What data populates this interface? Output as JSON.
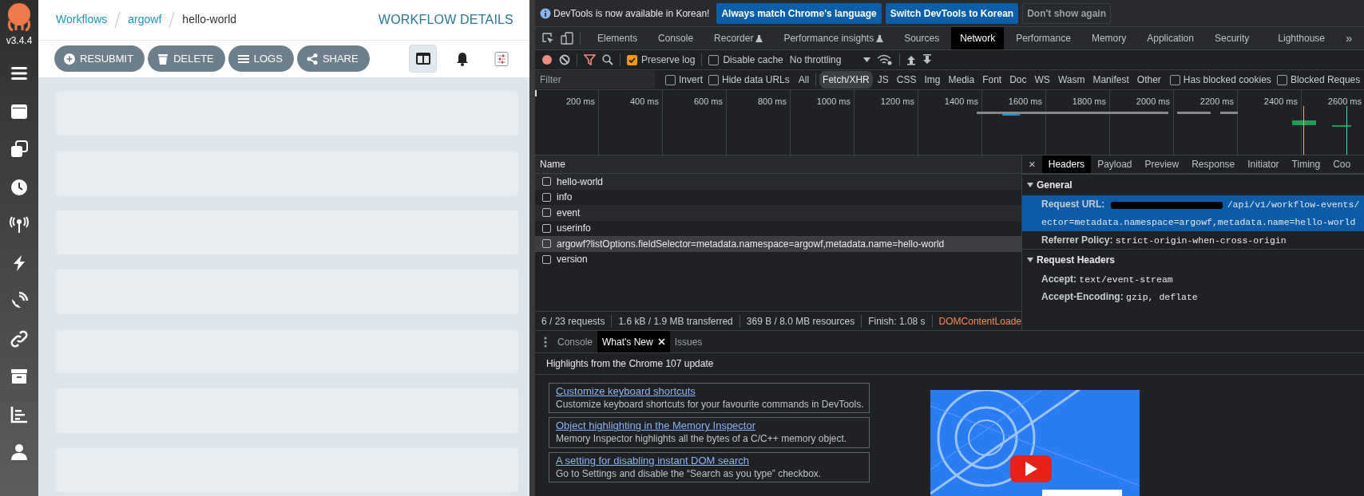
{
  "app": {
    "version": "v3.4.4",
    "breadcrumbs": [
      {
        "label": "Workflows",
        "link": true
      },
      {
        "label": "argowf",
        "link": true
      },
      {
        "label": "hello-world",
        "link": false
      }
    ],
    "page_title": "WORKFLOW DETAILS",
    "actions": [
      {
        "kind": "resubmit",
        "label": "RESUBMIT"
      },
      {
        "kind": "delete",
        "label": "DELETE"
      },
      {
        "kind": "logs",
        "label": "LOGS"
      },
      {
        "kind": "share",
        "label": "SHARE"
      }
    ],
    "view_buttons": [
      {
        "kind": "split",
        "selected": true
      },
      {
        "kind": "bell",
        "selected": false
      },
      {
        "kind": "settings",
        "selected": false
      }
    ]
  },
  "devtools": {
    "infobar": {
      "message": "DevTools is now available in Korean!",
      "buttons": [
        {
          "label": "Always match Chrome's language",
          "primary": true
        },
        {
          "label": "Switch DevTools to Korean",
          "primary": true
        },
        {
          "label": "Don't show again",
          "primary": false
        }
      ]
    },
    "tabs": [
      {
        "label": "Elements",
        "selected": false,
        "experimental": false
      },
      {
        "label": "Console",
        "selected": false,
        "experimental": false
      },
      {
        "label": "Recorder",
        "selected": false,
        "experimental": true
      },
      {
        "label": "Performance insights",
        "selected": false,
        "experimental": true
      },
      {
        "label": "Sources",
        "selected": false,
        "experimental": false
      },
      {
        "label": "Network",
        "selected": true,
        "experimental": false
      },
      {
        "label": "Performance",
        "selected": false,
        "experimental": false
      },
      {
        "label": "Memory",
        "selected": false,
        "experimental": false
      },
      {
        "label": "Application",
        "selected": false,
        "experimental": false
      },
      {
        "label": "Security",
        "selected": false,
        "experimental": false
      },
      {
        "label": "Lighthouse",
        "selected": false,
        "experimental": false
      }
    ],
    "more_tabs": "»",
    "toolbar": {
      "recording": true,
      "preserve_log": {
        "label": "Preserve log",
        "checked": true
      },
      "disable_cache": {
        "label": "Disable cache",
        "checked": false
      },
      "throttling": "No throttling"
    },
    "filter": {
      "placeholder": "Filter",
      "invert": {
        "label": "Invert",
        "checked": false
      },
      "hide_data_urls": {
        "label": "Hide data URLs",
        "checked": false
      },
      "types": [
        {
          "label": "All",
          "selected": false
        },
        {
          "label": "Fetch/XHR",
          "selected": true
        },
        {
          "label": "JS",
          "selected": false
        },
        {
          "label": "CSS",
          "selected": false
        },
        {
          "label": "Img",
          "selected": false
        },
        {
          "label": "Media",
          "selected": false
        },
        {
          "label": "Font",
          "selected": false
        },
        {
          "label": "Doc",
          "selected": false
        },
        {
          "label": "WS",
          "selected": false
        },
        {
          "label": "Wasm",
          "selected": false
        },
        {
          "label": "Manifest",
          "selected": false
        },
        {
          "label": "Other",
          "selected": false
        }
      ],
      "has_blocked_cookies": {
        "label": "Has blocked cookies",
        "checked": false
      },
      "blocked_requests": {
        "label": "Blocked Reques",
        "checked": false
      }
    },
    "timeline": {
      "ticks": [
        "200 ms",
        "400 ms",
        "600 ms",
        "800 ms",
        "1000 ms",
        "1200 ms",
        "1400 ms",
        "1600 ms",
        "1800 ms",
        "2000 ms",
        "2200 ms",
        "2400 ms",
        "2600 ms"
      ]
    },
    "requests": {
      "column": "Name",
      "rows": [
        {
          "name": "hello-world",
          "selected": false
        },
        {
          "name": "info",
          "selected": false
        },
        {
          "name": "event",
          "selected": false
        },
        {
          "name": "userinfo",
          "selected": false
        },
        {
          "name": "argowf?listOptions.fieldSelector=metadata.namespace=argowf,metadata.name=hello-world",
          "selected": true
        },
        {
          "name": "version",
          "selected": false
        }
      ]
    },
    "summary": [
      {
        "kind": "plain",
        "text": "6 / 23 requests"
      },
      {
        "kind": "plain",
        "text": "1.6 kB / 1.9 MB transferred"
      },
      {
        "kind": "plain",
        "text": "369 B / 8.0 MB resources"
      },
      {
        "kind": "plain",
        "text": "Finish: 1.08 s"
      },
      {
        "kind": "event",
        "text": "DOMContentLoade"
      }
    ],
    "details": {
      "close": "×",
      "tabs": [
        {
          "label": "Headers",
          "selected": true
        },
        {
          "label": "Payload",
          "selected": false
        },
        {
          "label": "Preview",
          "selected": false
        },
        {
          "label": "Response",
          "selected": false
        },
        {
          "label": "Initiator",
          "selected": false
        },
        {
          "label": "Timing",
          "selected": false
        },
        {
          "label": "Coo",
          "selected": false
        }
      ],
      "sections": [
        {
          "title": "General",
          "expanded": true,
          "rows": [
            {
              "key": "Request URL:",
              "value_lines": [
                "/api/v1/workflow-events/",
                "ector=metadata.namespace=argowf,metadata.name=hello-world"
              ],
              "selected": true,
              "redacted": true
            },
            {
              "key": "Referrer Policy:",
              "value_lines": [
                "strict-origin-when-cross-origin"
              ],
              "selected": false,
              "redacted": false
            }
          ]
        },
        {
          "title": "Request Headers",
          "expanded": true,
          "rows": [
            {
              "key": "Accept:",
              "value_lines": [
                "text/event-stream"
              ],
              "selected": false,
              "redacted": false
            },
            {
              "key": "Accept-Encoding:",
              "value_lines": [
                "gzip, deflate"
              ],
              "selected": false,
              "redacted": false
            }
          ]
        }
      ]
    },
    "drawer": {
      "tabs": [
        {
          "label": "Console",
          "selected": false,
          "closable": false
        },
        {
          "label": "What's New",
          "selected": true,
          "closable": true
        },
        {
          "label": "Issues",
          "selected": false,
          "closable": false
        }
      ],
      "heading": "Highlights from the Chrome 107 update",
      "items": [
        {
          "title": "Customize keyboard shortcuts",
          "description": "Customize keyboard shortcuts for your favourite commands in DevTools."
        },
        {
          "title": "Object highlighting in the Memory Inspector",
          "description": "Memory Inspector highlights all the bytes of a C/C++ memory object."
        },
        {
          "title": "A setting for disabling instant DOM search",
          "description": "Go to Settings and disable the “Search as you type” checkbox."
        }
      ]
    }
  }
}
